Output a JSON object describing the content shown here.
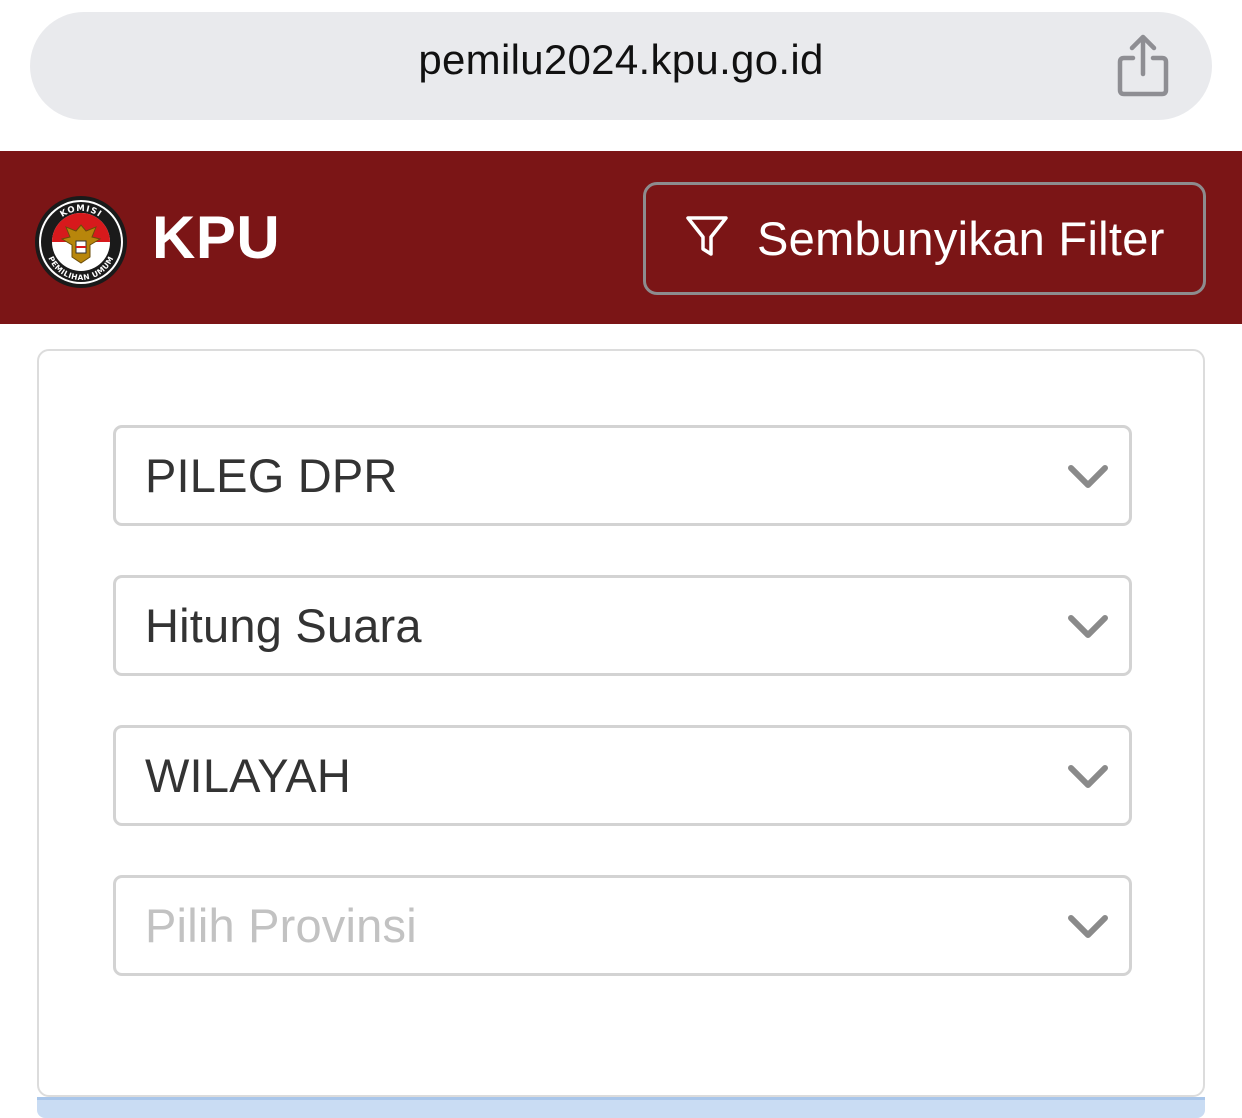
{
  "browser": {
    "url": "pemilu2024.kpu.go.id",
    "share_icon": "share-icon"
  },
  "header": {
    "logo_top_text": "KOMISI",
    "logo_bottom_text": "PEMILIHAN UMUM",
    "brand": "KPU",
    "filter_button_label": "Sembunyikan Filter",
    "filter_icon": "filter-icon",
    "background_color": "#7b1516"
  },
  "filters": [
    {
      "value": "PILEG DPR",
      "is_placeholder": false
    },
    {
      "value": "Hitung Suara",
      "is_placeholder": false
    },
    {
      "value": "WILAYAH",
      "is_placeholder": false
    },
    {
      "value": "Pilih Provinsi",
      "is_placeholder": true
    }
  ]
}
